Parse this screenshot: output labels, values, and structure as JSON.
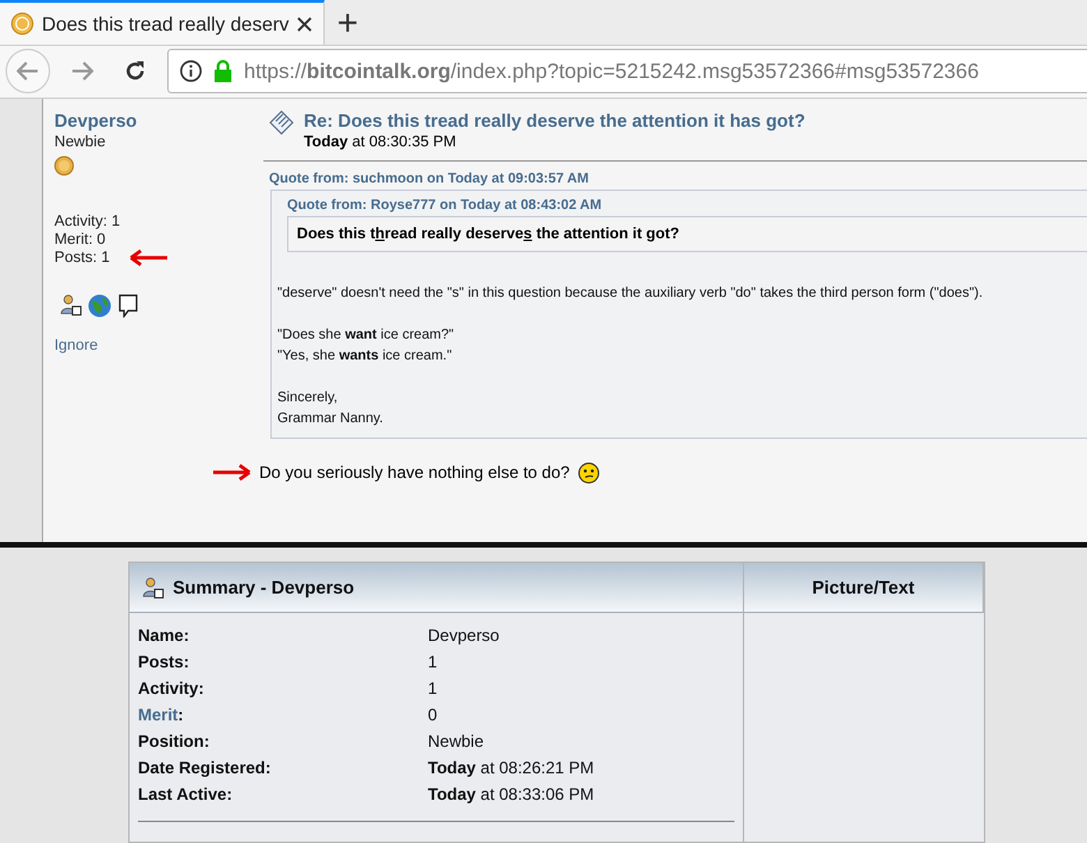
{
  "browser": {
    "tab": {
      "title": "Does this tread really deserv",
      "selected": true
    },
    "new_tab": "+",
    "url": "https://**bitcointalk.org**/index.php?topic=5215242.msg53572366#msg53572366"
  },
  "poster": {
    "name": "Devperso",
    "rank": "Newbie",
    "stats": [
      "Activity: 1",
      "Merit: 0",
      "Posts: 1"
    ],
    "ignore": "Ignore"
  },
  "post": {
    "title": "Re: Does this tread really deserve the attention it has got?",
    "date_bold": "Today",
    "date_rest": " at 08:30:35 PM",
    "quote": {
      "header": "Quote from: suchmoon on Today at 09:03:57 AM",
      "inner_header": "Quote from: Royse777 on Today at 08:43:02 AM",
      "inner_parts": [
        {
          "text": "Does this t",
          "underlined": false
        },
        {
          "text": "h",
          "underlined": true
        },
        {
          "text": "read really deserve",
          "underlined": false
        },
        {
          "text": "s",
          "underlined": true
        },
        {
          "text": " the attention it got?",
          "underlined": false
        }
      ],
      "paragraphs": [
        [
          "\"deserve\" doesn't need the \"s\" in this question because the auxiliary verb \"do\" takes the third person form (\"does\")."
        ],
        [
          "\"Does she **want** ice cream?\"",
          "\"Yes, she **wants** ice cream.\""
        ],
        [
          "Sincerely,",
          "Grammar Nanny."
        ]
      ]
    },
    "reply": "Do you seriously have nothing else to do?"
  },
  "summary": {
    "title": "Summary - Devperso",
    "side_title": "Picture/Text",
    "rows": [
      {
        "label": "Name",
        "link": false,
        "suffix": ":",
        "value": "Devperso"
      },
      {
        "label": "Posts",
        "link": false,
        "suffix": ":",
        "value": "1"
      },
      {
        "label": "Activity",
        "link": false,
        "suffix": ":",
        "value": "1"
      },
      {
        "label": "Merit",
        "link": true,
        "suffix": ":",
        "value": "0"
      },
      {
        "label": "Position",
        "link": false,
        "suffix": ":",
        "value": "Newbie"
      },
      {
        "label": "Date Registered",
        "link": false,
        "suffix": ":",
        "value": "**Today** at 08:26:21 PM"
      },
      {
        "label": "Last Active",
        "link": false,
        "suffix": ":",
        "value": "**Today** at 08:33:06 PM"
      }
    ]
  }
}
